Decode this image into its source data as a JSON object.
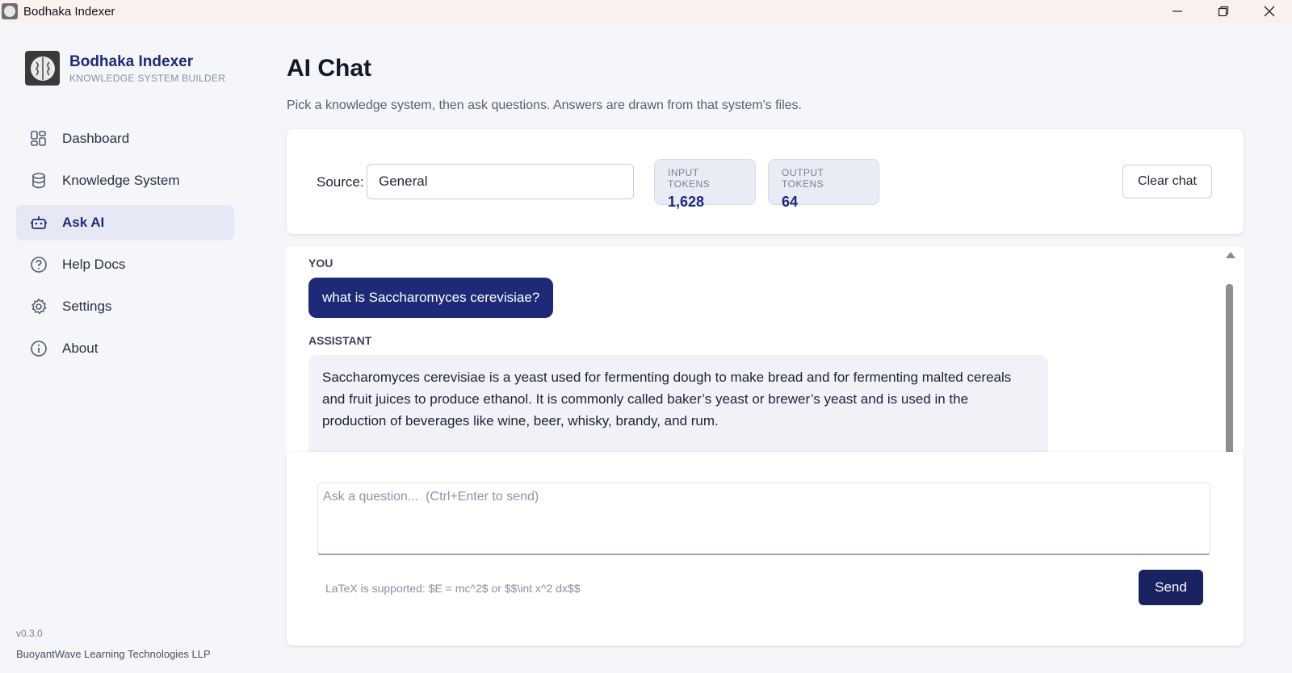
{
  "window": {
    "title": "Bodhaka Indexer"
  },
  "sidebar": {
    "brand_title": "Bodhaka Indexer",
    "brand_subtitle": "KNOWLEDGE SYSTEM BUILDER",
    "items": [
      {
        "label": "Dashboard",
        "icon": "dashboard-icon"
      },
      {
        "label": "Knowledge System",
        "icon": "database-icon"
      },
      {
        "label": "Ask AI",
        "icon": "robot-icon",
        "active": true
      },
      {
        "label": "Help Docs",
        "icon": "help-circle-icon"
      },
      {
        "label": "Settings",
        "icon": "gear-icon"
      },
      {
        "label": "About",
        "icon": "info-icon"
      }
    ],
    "version": "v0.3.0",
    "company": "BuoyantWave Learning Technologies LLP"
  },
  "main": {
    "title": "AI Chat",
    "description": "Pick a knowledge system, then ask questions. Answers are drawn from that system's files.",
    "source": {
      "label": "Source:",
      "value": "General"
    },
    "tokens": {
      "input_label": "INPUT TOKENS",
      "input_value": "1,628",
      "output_label": "OUTPUT TOKENS",
      "output_value": "64"
    },
    "clear_label": "Clear chat",
    "chat": {
      "user_role": "YOU",
      "user_message": "what is Saccharomyces cerevisiae?",
      "assistant_role": "ASSISTANT",
      "assistant_message": "Saccharomyces cerevisiae is a yeast used for fermenting dough to make bread and for fermenting malted cereals and fruit juices to produce ethanol. It is commonly called baker’s yeast or brewer’s yeast and is used in the production of beverages like wine, beer, whisky, brandy, and rum."
    },
    "composer": {
      "placeholder": "Ask a question...  (Ctrl+Enter to send)",
      "latex_hint": "LaTeX is supported: $E = mc^2$ or $$\\int x^2 dx$$",
      "send_label": "Send"
    }
  },
  "colors": {
    "accent": "#1e2a78",
    "send_button": "#1a2260",
    "titlebar": "#faf1ef"
  }
}
